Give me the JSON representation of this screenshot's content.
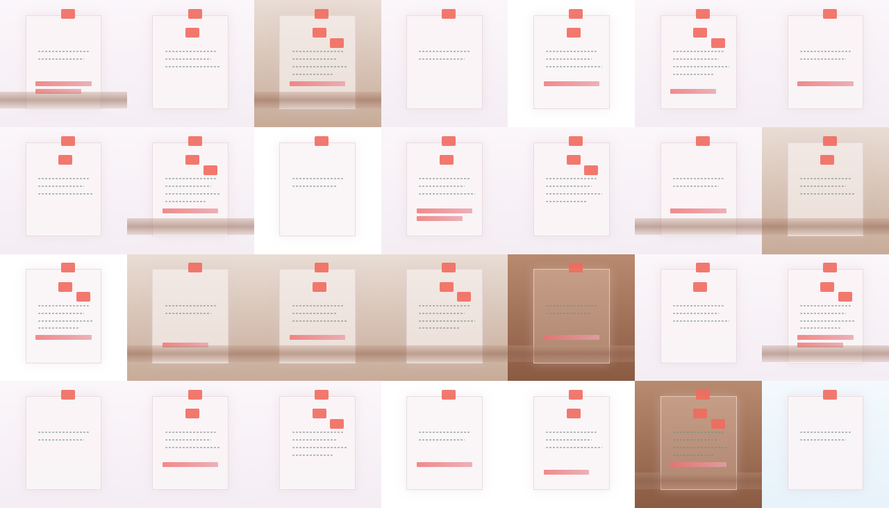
{
  "grid": {
    "rows": 4,
    "cols": 7
  },
  "tiles": [
    {
      "variant": "light",
      "content": "window"
    },
    {
      "variant": "light",
      "content": "window"
    },
    {
      "variant": "dark",
      "content": "window"
    },
    {
      "variant": "light",
      "content": "window"
    },
    {
      "variant": "plain",
      "content": "window"
    },
    {
      "variant": "light",
      "content": "window"
    },
    {
      "variant": "light",
      "content": "window"
    },
    {
      "variant": "light",
      "content": "window"
    },
    {
      "variant": "light",
      "content": "window"
    },
    {
      "variant": "plain",
      "content": "window"
    },
    {
      "variant": "light",
      "content": "window"
    },
    {
      "variant": "light",
      "content": "window"
    },
    {
      "variant": "light",
      "content": "window"
    },
    {
      "variant": "dark",
      "content": "window"
    },
    {
      "variant": "plain",
      "content": "window"
    },
    {
      "variant": "dark",
      "content": "window"
    },
    {
      "variant": "dark",
      "content": "window"
    },
    {
      "variant": "dark",
      "content": "window"
    },
    {
      "variant": "brown",
      "content": "window"
    },
    {
      "variant": "light",
      "content": "window"
    },
    {
      "variant": "light",
      "content": "window"
    },
    {
      "variant": "light",
      "content": "window"
    },
    {
      "variant": "light",
      "content": "window"
    },
    {
      "variant": "light",
      "content": "window"
    },
    {
      "variant": "plain",
      "content": "window"
    },
    {
      "variant": "plain",
      "content": "window"
    },
    {
      "variant": "brown",
      "content": "window"
    },
    {
      "variant": "blue",
      "content": "window"
    }
  ],
  "colors": {
    "accent": "#f16a5e",
    "text_muted": "#6f8e82"
  }
}
